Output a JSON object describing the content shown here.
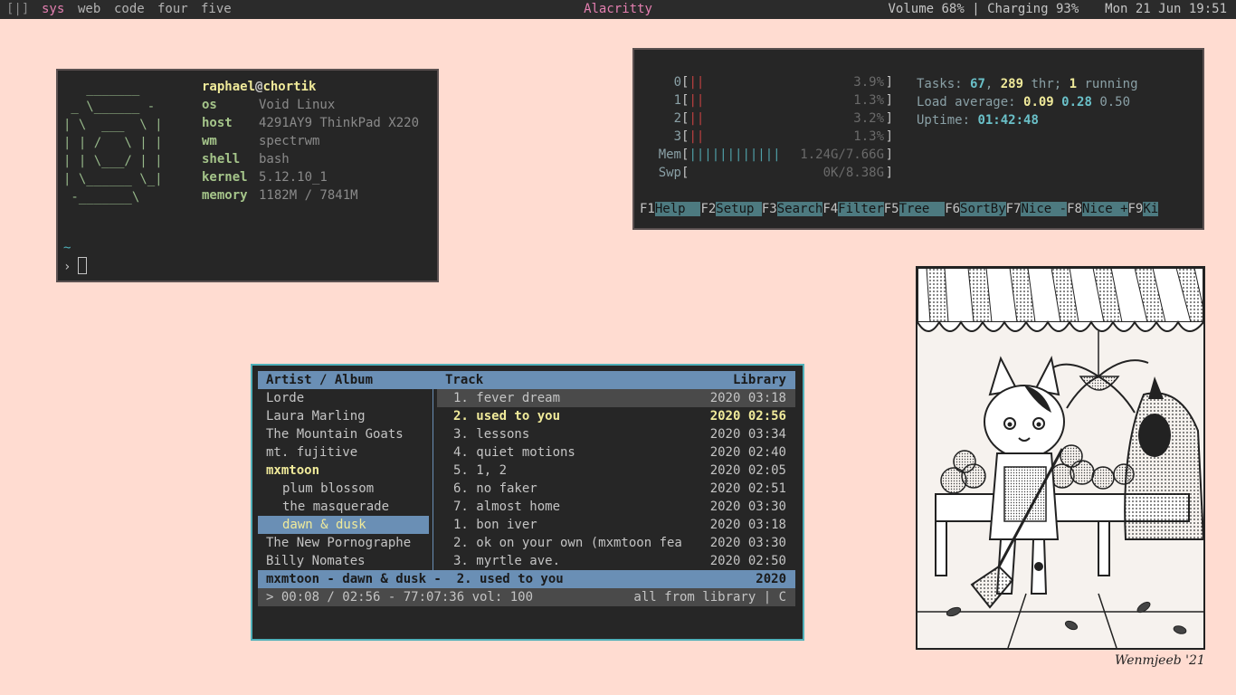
{
  "bar": {
    "layout_indicator": "[|]",
    "workspaces": [
      "sys",
      "web",
      "code",
      "four",
      "five"
    ],
    "active_workspace": "sys",
    "title": "Alacritty",
    "volume": "Volume 68%",
    "separator": "|",
    "battery": "Charging 93%",
    "datetime": "Mon 21 Jun 19:51"
  },
  "fetch": {
    "ascii_art": "   _______\n _ \\______ -\n| \\  ___  \\ |\n| | /   \\ | |\n| | \\___/ | |\n| \\______ \\_|\n -_______\\",
    "user": "raphael",
    "at": "@",
    "host_name": "chortik",
    "rows": [
      {
        "key": "os",
        "value": "Void Linux"
      },
      {
        "key": "host",
        "value": "4291AY9 ThinkPad X220"
      },
      {
        "key": "wm",
        "value": "spectrwm"
      },
      {
        "key": "shell",
        "value": "bash"
      },
      {
        "key": "kernel",
        "value": "5.12.10_1"
      },
      {
        "key": "memory",
        "value": "1182M / 7841M"
      }
    ],
    "cwd": "~",
    "prompt": "›"
  },
  "htop": {
    "cpus": [
      {
        "id": "0",
        "bar": "||",
        "pct": "3.9%"
      },
      {
        "id": "1",
        "bar": "||",
        "pct": "1.3%"
      },
      {
        "id": "2",
        "bar": "||",
        "pct": "3.2%"
      },
      {
        "id": "3",
        "bar": "||",
        "pct": "1.3%"
      }
    ],
    "mem": {
      "label": "Mem",
      "bar": "||||||||||||",
      "value": "1.24G/7.66G"
    },
    "swp": {
      "label": "Swp",
      "bar": "",
      "value": "0K/8.38G"
    },
    "tasks_label": "Tasks:",
    "tasks": "67",
    "threads": "289",
    "thr_label": "thr;",
    "running": "1",
    "running_label": "running",
    "load_label": "Load average:",
    "load1": "0.09",
    "load5": "0.28",
    "load15": "0.50",
    "uptime_label": "Uptime:",
    "uptime": "01:42:48",
    "fkeys": [
      {
        "key": "F1",
        "label": "Help  "
      },
      {
        "key": "F2",
        "label": "Setup "
      },
      {
        "key": "F3",
        "label": "Search"
      },
      {
        "key": "F4",
        "label": "Filter"
      },
      {
        "key": "F5",
        "label": "Tree  "
      },
      {
        "key": "F6",
        "label": "SortBy"
      },
      {
        "key": "F7",
        "label": "Nice -"
      },
      {
        "key": "F8",
        "label": "Nice +"
      },
      {
        "key": "F9",
        "label": "Ki"
      }
    ]
  },
  "cmus": {
    "header": {
      "artist_album": "Artist / Album",
      "track": "Track",
      "library": "Library"
    },
    "artists": [
      {
        "name": "Lorde",
        "kind": "artist"
      },
      {
        "name": "Laura Marling",
        "kind": "artist"
      },
      {
        "name": "The Mountain Goats",
        "kind": "artist"
      },
      {
        "name": "mt. fujitive",
        "kind": "artist"
      },
      {
        "name": "mxmtoon",
        "kind": "artist-active"
      },
      {
        "name": "plum blossom",
        "kind": "album"
      },
      {
        "name": "the masquerade",
        "kind": "album"
      },
      {
        "name": "dawn & dusk",
        "kind": "album-selected"
      },
      {
        "name": "The New Pornographe",
        "kind": "artist"
      },
      {
        "name": "Billy Nomates",
        "kind": "artist"
      }
    ],
    "tracks": [
      {
        "name": "1. fever dream",
        "year": "2020",
        "length": "03:18",
        "state": "cursor"
      },
      {
        "name": "2. used to you",
        "year": "2020",
        "length": "02:56",
        "state": "playing"
      },
      {
        "name": "3. lessons",
        "year": "2020",
        "length": "03:34",
        "state": ""
      },
      {
        "name": "4. quiet motions",
        "year": "2020",
        "length": "02:40",
        "state": ""
      },
      {
        "name": "5. 1, 2",
        "year": "2020",
        "length": "02:05",
        "state": ""
      },
      {
        "name": "6. no faker",
        "year": "2020",
        "length": "02:51",
        "state": ""
      },
      {
        "name": "7. almost home",
        "year": "2020",
        "length": "03:30",
        "state": ""
      },
      {
        "name": "1. bon iver",
        "year": "2020",
        "length": "03:18",
        "state": ""
      },
      {
        "name": "2. ok on your own (mxmtoon fea",
        "year": "2020",
        "length": "03:30",
        "state": ""
      },
      {
        "name": "3. myrtle ave.",
        "year": "2020",
        "length": "02:50",
        "state": ""
      }
    ],
    "now_playing": "mxmtoon - dawn & dusk -  2. used to you",
    "now_playing_year": "2020",
    "status_left": "> 00:08 / 02:56 - 77:07:36 vol: 100",
    "status_right": "all from library | C"
  },
  "artwork": {
    "signature": "Wenmjeeb '21"
  }
}
